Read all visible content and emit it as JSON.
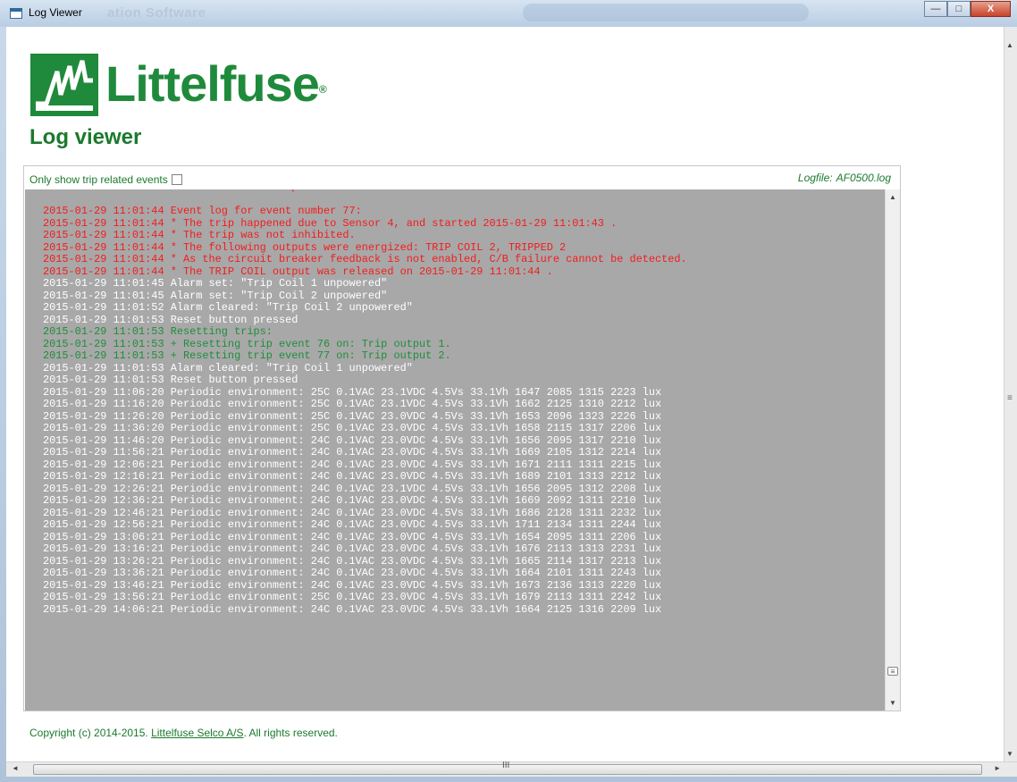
{
  "window": {
    "title": "Log Viewer",
    "ghost_title": "ation Software"
  },
  "controls": {
    "minimize": "—",
    "maximize": "□",
    "close": "X"
  },
  "brand": {
    "name": "Littelfuse",
    "mark": "®"
  },
  "page": {
    "title": "Log viewer"
  },
  "filter": {
    "label": "Only show trip related events",
    "checked": false
  },
  "logfile": {
    "label": "Logfile:",
    "name": "AF0500.log"
  },
  "log": [
    {
      "text": "2015-01-29 11:01:44 * The TRIP COIL output was released on 2015-01-29 11:01:44 .",
      "color": "red"
    },
    {
      "text": "",
      "color": "white"
    },
    {
      "text": "2015-01-29 11:01:44 Event log for event number 77:",
      "color": "red"
    },
    {
      "text": "2015-01-29 11:01:44 * The trip happened due to Sensor 4, and started 2015-01-29 11:01:43 .",
      "color": "red"
    },
    {
      "text": "2015-01-29 11:01:44 * The trip was not inhibited.",
      "color": "red"
    },
    {
      "text": "2015-01-29 11:01:44 * The following outputs were energized: TRIP COIL 2, TRIPPED 2",
      "color": "red"
    },
    {
      "text": "2015-01-29 11:01:44 * As the circuit breaker feedback is not enabled, C/B failure cannot be detected.",
      "color": "red"
    },
    {
      "text": "2015-01-29 11:01:44 * The TRIP COIL output was released on 2015-01-29 11:01:44 .",
      "color": "red"
    },
    {
      "text": "2015-01-29 11:01:45 Alarm set: \"Trip Coil 1 unpowered\"",
      "color": "white"
    },
    {
      "text": "2015-01-29 11:01:45 Alarm set: \"Trip Coil 2 unpowered\"",
      "color": "white"
    },
    {
      "text": "2015-01-29 11:01:52 Alarm cleared: \"Trip Coil 2 unpowered\"",
      "color": "white"
    },
    {
      "text": "2015-01-29 11:01:53 Reset button pressed",
      "color": "white"
    },
    {
      "text": "2015-01-29 11:01:53 Resetting trips:",
      "color": "green"
    },
    {
      "text": "2015-01-29 11:01:53 + Resetting trip event 76 on: Trip output 1.",
      "color": "green"
    },
    {
      "text": "2015-01-29 11:01:53 + Resetting trip event 77 on: Trip output 2.",
      "color": "green"
    },
    {
      "text": "2015-01-29 11:01:53 Alarm cleared: \"Trip Coil 1 unpowered\"",
      "color": "white"
    },
    {
      "text": "2015-01-29 11:01:53 Reset button pressed",
      "color": "white"
    },
    {
      "text": "2015-01-29 11:06:20 Periodic environment: 25C 0.1VAC 23.1VDC 4.5Vs 33.1Vh 1647 2085 1315 2223 lux",
      "color": "white"
    },
    {
      "text": "2015-01-29 11:16:20 Periodic environment: 25C 0.1VAC 23.1VDC 4.5Vs 33.1Vh 1662 2125 1310 2212 lux",
      "color": "white"
    },
    {
      "text": "2015-01-29 11:26:20 Periodic environment: 25C 0.1VAC 23.0VDC 4.5Vs 33.1Vh 1653 2096 1323 2226 lux",
      "color": "white"
    },
    {
      "text": "2015-01-29 11:36:20 Periodic environment: 25C 0.1VAC 23.0VDC 4.5Vs 33.1Vh 1658 2115 1317 2206 lux",
      "color": "white"
    },
    {
      "text": "2015-01-29 11:46:20 Periodic environment: 24C 0.1VAC 23.0VDC 4.5Vs 33.1Vh 1656 2095 1317 2210 lux",
      "color": "white"
    },
    {
      "text": "2015-01-29 11:56:21 Periodic environment: 24C 0.1VAC 23.0VDC 4.5Vs 33.1Vh 1669 2105 1312 2214 lux",
      "color": "white"
    },
    {
      "text": "2015-01-29 12:06:21 Periodic environment: 24C 0.1VAC 23.0VDC 4.5Vs 33.1Vh 1671 2111 1311 2215 lux",
      "color": "white"
    },
    {
      "text": "2015-01-29 12:16:21 Periodic environment: 24C 0.1VAC 23.0VDC 4.5Vs 33.1Vh 1689 2101 1313 2212 lux",
      "color": "white"
    },
    {
      "text": "2015-01-29 12:26:21 Periodic environment: 24C 0.1VAC 23.1VDC 4.5Vs 33.1Vh 1656 2095 1312 2208 lux",
      "color": "white"
    },
    {
      "text": "2015-01-29 12:36:21 Periodic environment: 24C 0.1VAC 23.0VDC 4.5Vs 33.1Vh 1669 2092 1311 2210 lux",
      "color": "white"
    },
    {
      "text": "2015-01-29 12:46:21 Periodic environment: 24C 0.1VAC 23.0VDC 4.5Vs 33.1Vh 1686 2128 1311 2232 lux",
      "color": "white"
    },
    {
      "text": "2015-01-29 12:56:21 Periodic environment: 24C 0.1VAC 23.0VDC 4.5Vs 33.1Vh 1711 2134 1311 2244 lux",
      "color": "white"
    },
    {
      "text": "2015-01-29 13:06:21 Periodic environment: 24C 0.1VAC 23.0VDC 4.5Vs 33.1Vh 1654 2095 1311 2206 lux",
      "color": "white"
    },
    {
      "text": "2015-01-29 13:16:21 Periodic environment: 24C 0.1VAC 23.0VDC 4.5Vs 33.1Vh 1676 2113 1313 2231 lux",
      "color": "white"
    },
    {
      "text": "2015-01-29 13:26:21 Periodic environment: 24C 0.1VAC 23.0VDC 4.5Vs 33.1Vh 1665 2114 1317 2213 lux",
      "color": "white"
    },
    {
      "text": "2015-01-29 13:36:21 Periodic environment: 24C 0.1VAC 23.0VDC 4.5Vs 33.1Vh 1664 2101 1311 2243 lux",
      "color": "white"
    },
    {
      "text": "2015-01-29 13:46:21 Periodic environment: 24C 0.1VAC 23.0VDC 4.5Vs 33.1Vh 1673 2136 1313 2220 lux",
      "color": "white"
    },
    {
      "text": "2015-01-29 13:56:21 Periodic environment: 25C 0.1VAC 23.0VDC 4.5Vs 33.1Vh 1679 2113 1311 2242 lux",
      "color": "white"
    },
    {
      "text": "2015-01-29 14:06:21 Periodic environment: 24C 0.1VAC 23.0VDC 4.5Vs 33.1Vh 1664 2125 1316 2209 lux",
      "color": "white"
    }
  ],
  "footer": {
    "text": "Copyright (c) 2014-2015.",
    "link": "Littelfuse Selco A/S",
    "suffix": ". All rights reserved."
  },
  "colors": {
    "brand_green": "#1f8a3b",
    "log_bg": "#a8a8a8",
    "log_red": "#f41c1c",
    "log_green": "#1d8f3a"
  }
}
